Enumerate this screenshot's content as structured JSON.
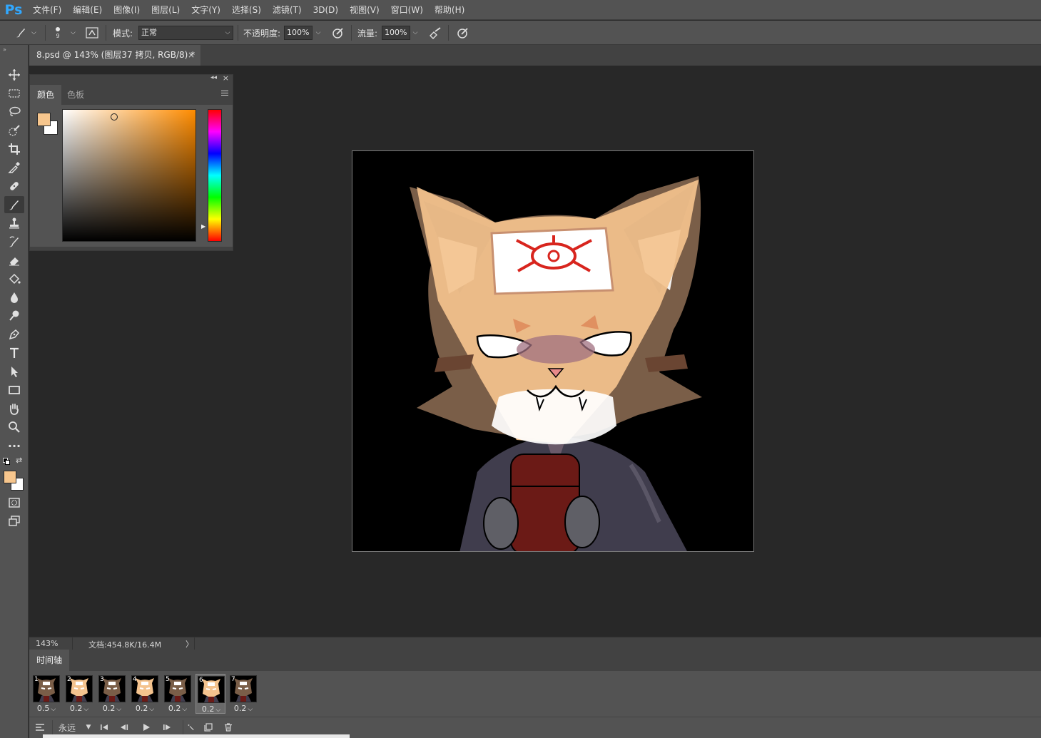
{
  "app": {
    "logo": "Ps"
  },
  "menu": [
    "文件(F)",
    "编辑(E)",
    "图像(I)",
    "图层(L)",
    "文字(Y)",
    "选择(S)",
    "滤镜(T)",
    "3D(D)",
    "视图(V)",
    "窗口(W)",
    "帮助(H)"
  ],
  "options": {
    "brush_size": "9",
    "mode_label": "模式:",
    "mode_value": "正常",
    "opacity_label": "不透明度:",
    "opacity_value": "100%",
    "flow_label": "流量:",
    "flow_value": "100%"
  },
  "document": {
    "tab_title": "8.psd @ 143% (图层37 拷贝, RGB/8) *",
    "close": "×"
  },
  "color_panel": {
    "tabs": [
      "颜色",
      "色板"
    ],
    "foreground": "#f7c68d",
    "background": "#ffffff",
    "hue": "#ff8c00"
  },
  "status": {
    "zoom": "143%",
    "doc_info": "文档:454.8K/16.4M",
    "arrow": "〉"
  },
  "timeline": {
    "tab": "时间轴",
    "frames": [
      {
        "num": "1",
        "delay": "0.5"
      },
      {
        "num": "2",
        "delay": "0.2"
      },
      {
        "num": "3",
        "delay": "0.2"
      },
      {
        "num": "4",
        "delay": "0.2"
      },
      {
        "num": "5",
        "delay": "0.2"
      },
      {
        "num": "6",
        "delay": "0.2",
        "selected": true
      },
      {
        "num": "7",
        "delay": "0.2"
      }
    ],
    "loop": "永远"
  },
  "colors": {
    "menubar": "#535353",
    "canvas": "#282828",
    "accent": "#31a8ff"
  }
}
